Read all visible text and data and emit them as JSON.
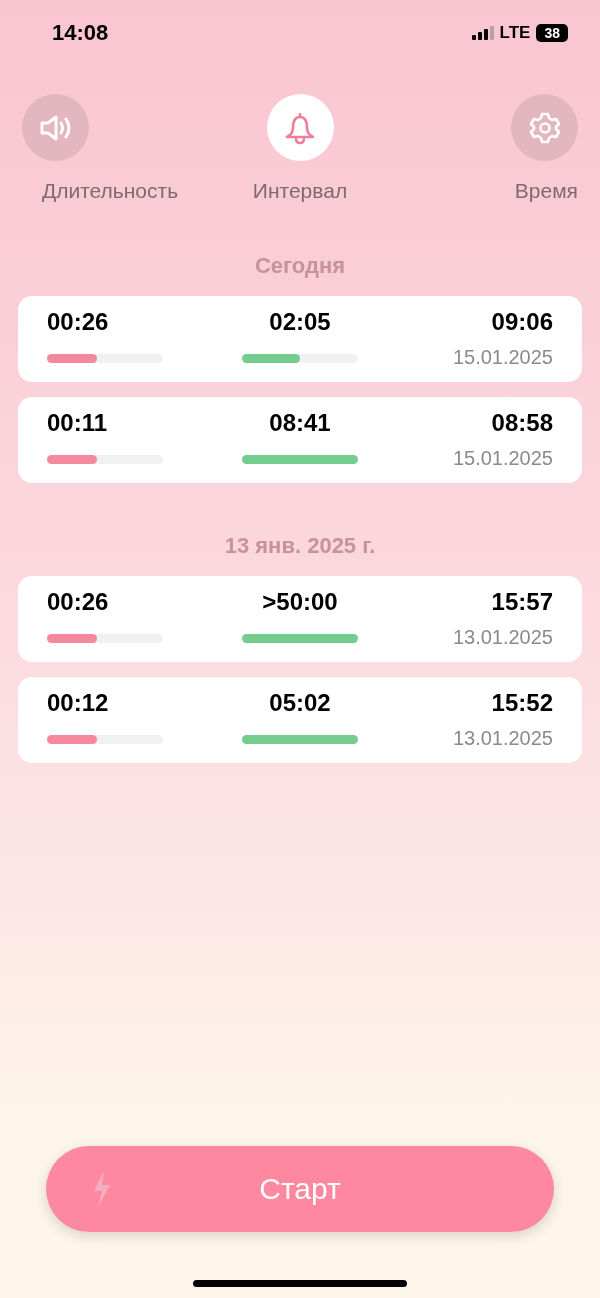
{
  "status_bar": {
    "time": "14:08",
    "network": "LTE",
    "battery": "38"
  },
  "tabs": [
    {
      "kind": "speaker",
      "label": "Длительность",
      "selected": false
    },
    {
      "kind": "bell",
      "label": "Интервал",
      "selected": true
    },
    {
      "kind": "gear",
      "label": "Время",
      "selected": false
    }
  ],
  "sections": [
    {
      "title": "Сегодня",
      "entries": [
        {
          "duration": {
            "value": "00:26",
            "level": 0.43
          },
          "interval": {
            "value": "02:05",
            "level": 0.5
          },
          "time": "09:06",
          "date": "15.01.2025"
        },
        {
          "duration": {
            "value": "00:11",
            "level": 0.43
          },
          "interval": {
            "value": "08:41",
            "level": 1
          },
          "time": "08:58",
          "date": "15.01.2025"
        }
      ]
    },
    {
      "title": "13 янв. 2025 г.",
      "entries": [
        {
          "duration": {
            "value": "00:26",
            "level": 0.43
          },
          "interval": {
            "value": ">50:00",
            "level": 1
          },
          "time": "15:57",
          "date": "13.01.2025"
        },
        {
          "duration": {
            "value": "00:12",
            "level": 0.43
          },
          "interval": {
            "value": "05:02",
            "level": 1
          },
          "time": "15:52",
          "date": "13.01.2025"
        }
      ]
    }
  ],
  "start_button": {
    "label": "Старт"
  }
}
